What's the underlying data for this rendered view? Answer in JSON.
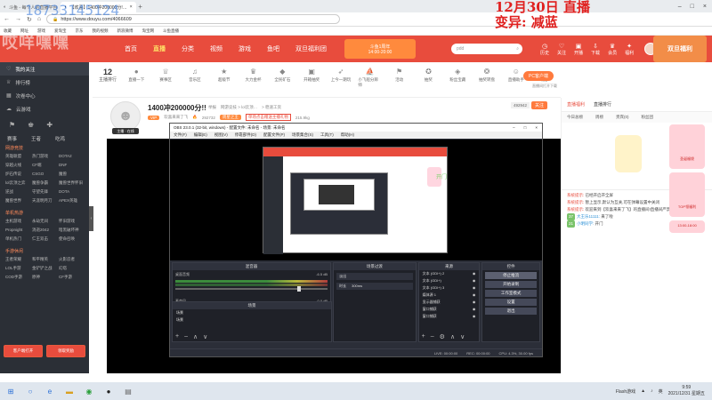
{
  "browser": {
    "tabs": [
      {
        "label": "斗鱼 - 每个人的直播平台",
        "active": false
      },
      {
        "label": "【欢喜】1400冲200000分!…",
        "active": true
      }
    ],
    "url": "https://www.douyu.com/4066609",
    "bookmarks": [
      "收藏",
      "网址",
      "游戏",
      "爱淘宝",
      "京东",
      "我的视频",
      "新浪微博",
      "淘宝网",
      "斗鱼直播"
    ]
  },
  "overlays": {
    "phone": "18733145124",
    "ghost": "哎咩嘿嘿",
    "date_line1": "12月30日 直播",
    "date_line2": "变异: 减蓝"
  },
  "header": {
    "nav": [
      "首页",
      "直播",
      "分类",
      "视频",
      "游戏",
      "鱼吧",
      "双旦福利团"
    ],
    "active_nav": "直播",
    "promo_line1": "斗鱼1周年",
    "promo_line2": "14:00-20:00",
    "search_placeholder": "pdd",
    "top_icons": [
      "历史",
      "关注",
      "开播",
      "下载",
      "会员",
      "福利"
    ],
    "banner": "双旦福利"
  },
  "sidebar": {
    "items": [
      "我的关注",
      "排行榜",
      "次卷中心",
      "云游戏"
    ],
    "icon_row": [
      "赛事",
      "王者",
      "吃鸡"
    ],
    "sections": [
      {
        "title": "网游竞技",
        "games": [
          "英雄联盟",
          "热门游戏",
          "DOTA2",
          "穿越火线",
          "CF端",
          "DNF",
          "炉石传说",
          "CSGO",
          "魔兽",
          "lol云顶之弈",
          "魔兽争霸",
          "魔兽世界怀旧",
          "逆战",
          "守望先锋",
          "DOTA",
          "魔兽世界",
          "天涯明月刀",
          "APEX英雄"
        ]
      },
      {
        "title": "单机热游",
        "games": [
          "主机游戏",
          "永劫无间",
          "怀旧游戏",
          "Propnight",
          "消逝2042",
          "暗黑破坏神",
          "单机热门",
          "仁王双击",
          "使命召唤"
        ]
      },
      {
        "title": "手游休闲",
        "games": [
          "王者荣耀",
          "和平精英",
          "火影忍者",
          "LOL手游",
          "金铲铲之战",
          "幻塔",
          "COD手游",
          "原神",
          "CF手游"
        ]
      }
    ],
    "btn_left": "客户端打开",
    "btn_right": "领取奖励"
  },
  "room": {
    "rank_label": "主播排行",
    "rank_value": "12",
    "icons": [
      "直播一下",
      "赛事区",
      "音乐区",
      "超级节",
      "大力金杯",
      "全民矿石",
      "开箱抽奖",
      "上今一期玩",
      "小飞船分辨师",
      "活动",
      "抽奖",
      "粉丝宝藏",
      "抽奖转盘",
      "直播助手",
      "更多"
    ],
    "title": "1400冲200000分!!",
    "meta": [
      "举报",
      "网游竞技 > lol云顶…",
      "> 稳速工资"
    ],
    "streamer_name": "欢喜来来了飞",
    "level_tag": "VIP",
    "hot": "292732",
    "badge": "周星之王",
    "notice": "单场点击赠送主播礼物",
    "fans": "215.9kg",
    "follow_count": "492942",
    "follow_label": "关注",
    "pc_button": "PC客户端",
    "pc_sub": "直播间打开下载",
    "av_tag": "主播 · 在线"
  },
  "obs": {
    "title": "OBS 23.0.1 (32-bit, windows) - 配置文件: 未命名 - 场景: 未命名",
    "menu": [
      "文件(F)",
      "编辑(E)",
      "视图(V)",
      "停靠部件(D)",
      "配置文件(P)",
      "场景集合(S)",
      "工具(T)",
      "帮助(H)"
    ],
    "docks": {
      "mixer": "混音器",
      "transitions": "场景过渡",
      "sources": "来源",
      "controls": "控件",
      "scenes": "场景"
    },
    "mixer_rows": [
      {
        "name": "桌面音频",
        "db": "-6.5 dB"
      },
      {
        "name": "麦克风",
        "db": "0.0 dB"
      }
    ],
    "scenes": [
      "场景",
      "场景"
    ],
    "transition_type": "淡出",
    "transition_duration_label": "时长",
    "transition_duration": "300ms",
    "sources": [
      "文本 (GDI+) 2",
      "文本 (GDI+)",
      "文本 (GDI+) 3",
      "媒体源 1",
      "显示器捕获",
      "窗口捕获",
      "窗口捕获"
    ],
    "controls": [
      "停止推流",
      "开始录制",
      "工作室模式",
      "设置",
      "退出"
    ],
    "status": [
      "LIVE: 00:00:00",
      "REC: 00:00:00",
      "CPU: 4.3%, 30.00 fps"
    ]
  },
  "player_side_text": "开门",
  "chat": {
    "tabs": [
      "直播福利",
      "直播排行"
    ],
    "sub_tabs": [
      "今日总榜",
      "周榜",
      "贵宾(0)",
      "粉丝团"
    ],
    "messages": [
      {
        "type": "sys",
        "tag": "系统提示:",
        "text": "已经开启开全屏"
      },
      {
        "type": "sys",
        "tag": "系统提示:",
        "text": "暂上显示,默认为互关,可在弹幕设置中关闭"
      },
      {
        "type": "sys",
        "tag": "系统提示:",
        "text": "欢迎来到【欢喜来来了飞】的直播间!直播间严禁出现未成年人..."
      },
      {
        "type": "user",
        "level": "37",
        "name": "大王乐11111:",
        "text": "来了啦"
      },
      {
        "type": "user",
        "level": "21",
        "name": "小明同学:",
        "text": "开门"
      }
    ],
    "ads": [
      "圣诞福袋",
      "TOP领福利",
      "13:00-18:00"
    ]
  },
  "taskbar": {
    "icons": [
      "start",
      "search",
      "ie",
      "explorer",
      "chrome",
      "obs",
      "store"
    ],
    "tray_text": "Flash游戏",
    "ime": "英",
    "clock_time": "9:59",
    "clock_date": "2021/12/31 星期五"
  }
}
